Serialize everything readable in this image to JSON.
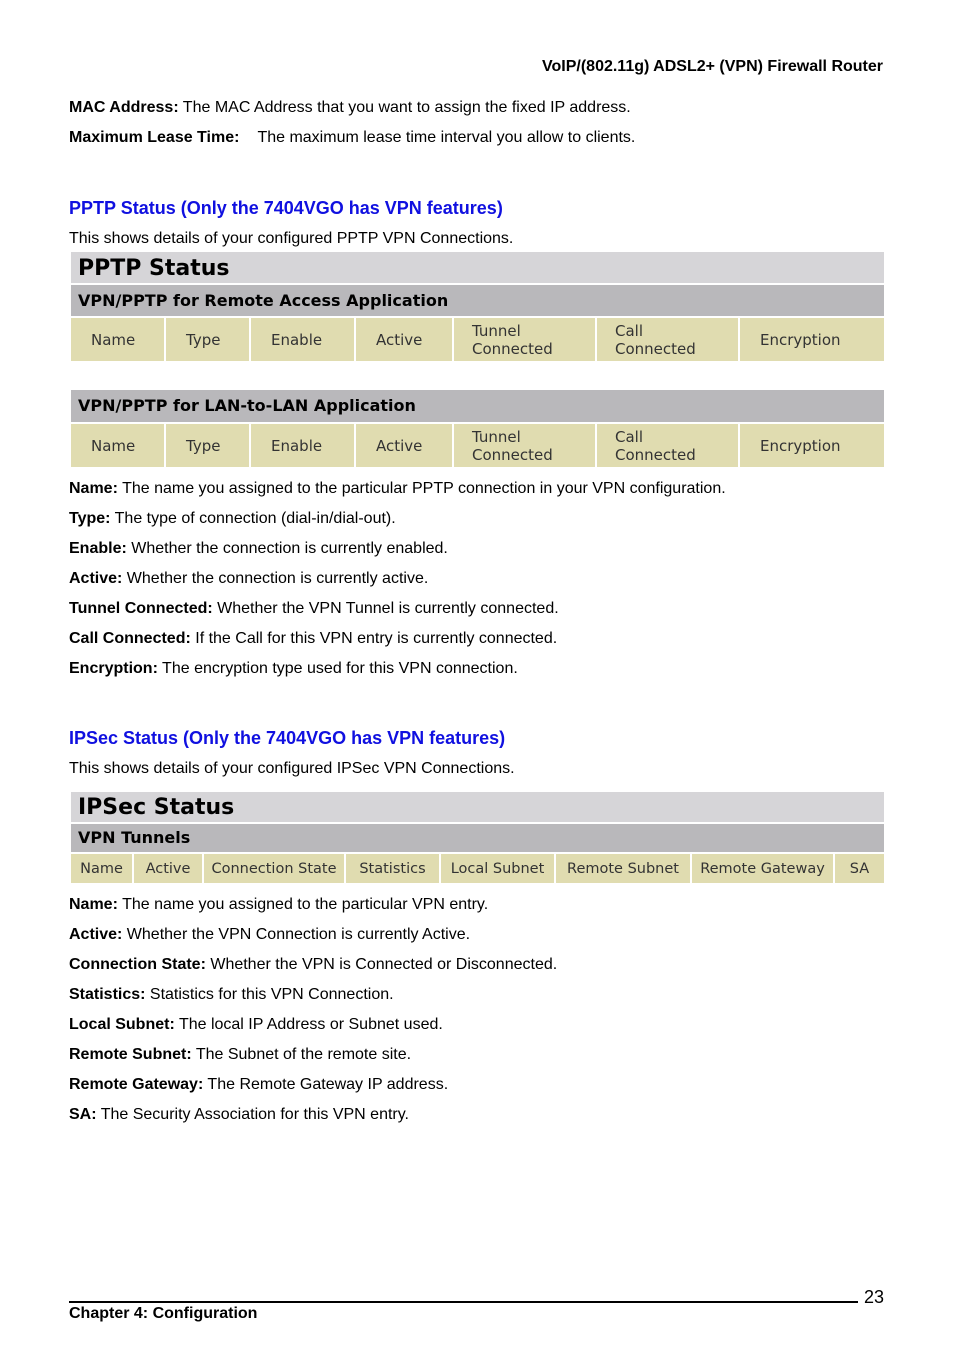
{
  "header": {
    "title": "VoIP/(802.11g) ADSL2+ (VPN) Firewall Router"
  },
  "intro": [
    {
      "term": "MAC Address:",
      "desc": " The MAC Address that you want to assign the fixed IP address."
    },
    {
      "term": "Maximum Lease Time:",
      "desc": "The maximum lease time interval you allow to clients."
    }
  ],
  "pptp": {
    "section_title": "PPTP Status (Only the 7404VGO has VPN features)",
    "intro": "This shows details of your configured PPTP VPN Connections.",
    "panel_title": "PPTP Status",
    "remote_access": {
      "title": "VPN/PPTP for Remote Access Application",
      "columns": [
        [
          "Name"
        ],
        [
          "Type"
        ],
        [
          "Enable"
        ],
        [
          "Active"
        ],
        [
          "Tunnel",
          "Connected"
        ],
        [
          "Call",
          "Connected"
        ],
        [
          "Encryption"
        ]
      ]
    },
    "lan_to_lan": {
      "title": "VPN/PPTP for LAN-to-LAN Application",
      "columns": [
        [
          "Name"
        ],
        [
          "Type"
        ],
        [
          "Enable"
        ],
        [
          "Active"
        ],
        [
          "Tunnel",
          "Connected"
        ],
        [
          "Call",
          "Connected"
        ],
        [
          "Encryption"
        ]
      ]
    },
    "definitions": [
      {
        "term": "Name:",
        "desc": " The name you assigned to the particular PPTP connection in your VPN configuration."
      },
      {
        "term": "Type:",
        "desc": " The type of connection (dial-in/dial-out)."
      },
      {
        "term": "Enable:",
        "desc": " Whether the connection is currently enabled."
      },
      {
        "term": "Active:",
        "desc": " Whether the connection is currently active."
      },
      {
        "term": "Tunnel Connected:",
        "desc": " Whether the VPN Tunnel is currently connected."
      },
      {
        "term": "Call Connected:",
        "desc": " If the Call for this VPN entry is currently connected."
      },
      {
        "term": "Encryption:",
        "desc": " The encryption type used for this VPN connection."
      }
    ]
  },
  "ipsec": {
    "section_title": "IPSec Status (Only the 7404VGO has VPN features)",
    "intro": "This shows details of your configured IPSec VPN Connections.",
    "panel_title": "IPSec Status",
    "tunnels": {
      "title": "VPN Tunnels",
      "columns": [
        "Name",
        "Active",
        "Connection State",
        "Statistics",
        "Local Subnet",
        "Remote Subnet",
        "Remote Gateway",
        "SA"
      ]
    },
    "definitions": [
      {
        "term": "Name:",
        "desc": " The name you assigned to the particular VPN entry."
      },
      {
        "term": "Active:",
        "desc": " Whether the VPN Connection is currently Active."
      },
      {
        "term": "Connection State:",
        "desc": " Whether the VPN is Connected or Disconnected."
      },
      {
        "term": "Statistics:",
        "desc": " Statistics for this VPN Connection."
      },
      {
        "term": "Local Subnet:",
        "desc": " The local IP Address or Subnet used."
      },
      {
        "term": "Remote Subnet:",
        "desc": " The Subnet of the remote site."
      },
      {
        "term": "Remote Gateway:",
        "desc": " The Remote Gateway IP address."
      },
      {
        "term": "SA:",
        "desc": " The Security Association for this VPN entry."
      }
    ]
  },
  "footer": {
    "chapter": "Chapter 4: Configuration",
    "page_number": "23"
  }
}
